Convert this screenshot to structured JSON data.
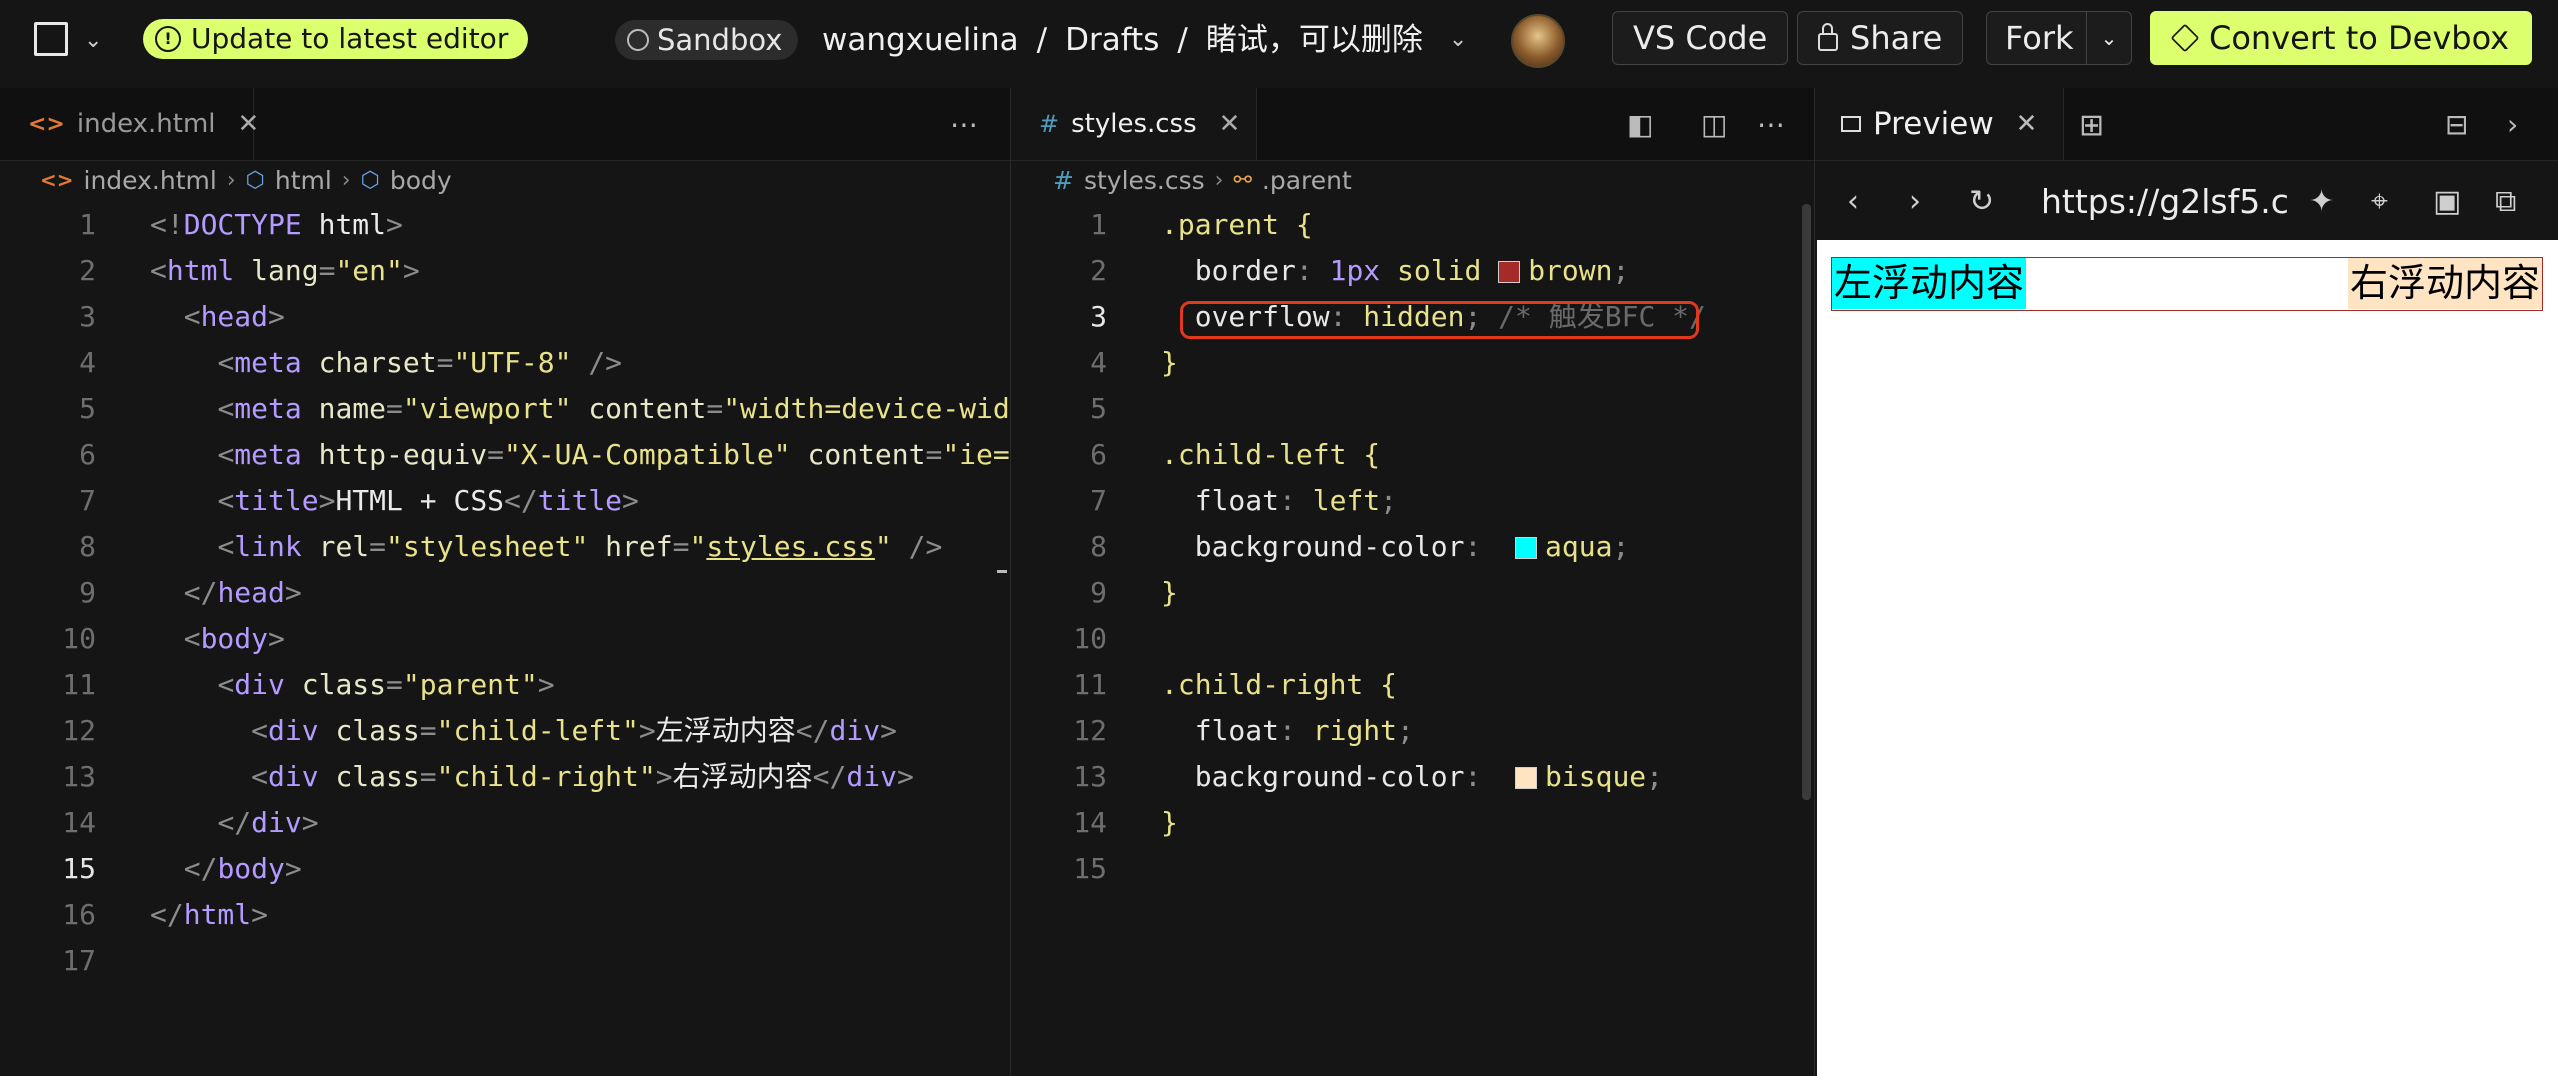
{
  "topbar": {
    "update_label": "Update to latest editor",
    "sandbox_label": "Sandbox",
    "path": [
      "wangxuelina",
      "/",
      "Drafts",
      "/",
      "睹试，可以删除"
    ],
    "vscode_label": "VS Code",
    "share_label": "Share",
    "fork_label": "Fork",
    "convert_label": "Convert to Devbox",
    "accent_color": "#dcff6e"
  },
  "left_pane": {
    "tab_label": "index.html",
    "breadcrumbs": [
      "index.html",
      "html",
      "body"
    ],
    "lines": [
      {
        "n": "1",
        "tokens": [
          [
            "p",
            "<!"
          ],
          [
            "tag",
            "DOCTYPE"
          ],
          [
            "txt",
            " html"
          ],
          [
            "p",
            ">"
          ]
        ]
      },
      {
        "n": "2",
        "tokens": [
          [
            "p",
            "<"
          ],
          [
            "tag",
            "html"
          ],
          [
            "attr",
            " lang"
          ],
          [
            "p",
            "="
          ],
          [
            "str",
            "\"en\""
          ],
          [
            "p",
            ">"
          ]
        ]
      },
      {
        "n": "3",
        "tokens": [
          [
            "txt",
            "  "
          ],
          [
            "p",
            "<"
          ],
          [
            "tag",
            "head"
          ],
          [
            "p",
            ">"
          ]
        ]
      },
      {
        "n": "4",
        "tokens": [
          [
            "txt",
            "    "
          ],
          [
            "p",
            "<"
          ],
          [
            "tag",
            "meta"
          ],
          [
            "attr",
            " charset"
          ],
          [
            "p",
            "="
          ],
          [
            "str",
            "\"UTF-8\""
          ],
          [
            "p",
            " />"
          ]
        ]
      },
      {
        "n": "5",
        "tokens": [
          [
            "txt",
            "    "
          ],
          [
            "p",
            "<"
          ],
          [
            "tag",
            "meta"
          ],
          [
            "attr",
            " name"
          ],
          [
            "p",
            "="
          ],
          [
            "str",
            "\"viewport\""
          ],
          [
            "attr",
            " content"
          ],
          [
            "p",
            "="
          ],
          [
            "str",
            "\"width=device-wid"
          ]
        ]
      },
      {
        "n": "6",
        "tokens": [
          [
            "txt",
            "    "
          ],
          [
            "p",
            "<"
          ],
          [
            "tag",
            "meta"
          ],
          [
            "attr",
            " http-equiv"
          ],
          [
            "p",
            "="
          ],
          [
            "str",
            "\"X-UA-Compatible\""
          ],
          [
            "attr",
            " content"
          ],
          [
            "p",
            "="
          ],
          [
            "str",
            "\"ie="
          ]
        ]
      },
      {
        "n": "7",
        "tokens": [
          [
            "txt",
            "    "
          ],
          [
            "p",
            "<"
          ],
          [
            "tag",
            "title"
          ],
          [
            "p",
            ">"
          ],
          [
            "txt",
            "HTML + CSS"
          ],
          [
            "p",
            "</"
          ],
          [
            "tag",
            "title"
          ],
          [
            "p",
            ">"
          ]
        ]
      },
      {
        "n": "8",
        "tokens": [
          [
            "txt",
            "    "
          ],
          [
            "p",
            "<"
          ],
          [
            "tag",
            "link"
          ],
          [
            "attr",
            " rel"
          ],
          [
            "p",
            "="
          ],
          [
            "str",
            "\"stylesheet\""
          ],
          [
            "attr",
            " href"
          ],
          [
            "p",
            "="
          ],
          [
            "str",
            "\""
          ],
          [
            "strU",
            "styles.css"
          ],
          [
            "str",
            "\""
          ],
          [
            "p",
            " />"
          ]
        ]
      },
      {
        "n": "9",
        "tokens": [
          [
            "txt",
            "  "
          ],
          [
            "p",
            "</"
          ],
          [
            "tag",
            "head"
          ],
          [
            "p",
            ">"
          ]
        ]
      },
      {
        "n": "10",
        "tokens": [
          [
            "txt",
            "  "
          ],
          [
            "p",
            "<"
          ],
          [
            "tag",
            "body"
          ],
          [
            "p",
            ">"
          ]
        ]
      },
      {
        "n": "11",
        "tokens": [
          [
            "txt",
            "    "
          ],
          [
            "p",
            "<"
          ],
          [
            "tag",
            "div"
          ],
          [
            "attr",
            " class"
          ],
          [
            "p",
            "="
          ],
          [
            "str",
            "\"parent\""
          ],
          [
            "p",
            ">"
          ]
        ]
      },
      {
        "n": "12",
        "tokens": [
          [
            "txt",
            "      "
          ],
          [
            "p",
            "<"
          ],
          [
            "tag",
            "div"
          ],
          [
            "attr",
            " class"
          ],
          [
            "p",
            "="
          ],
          [
            "str",
            "\"child-left\""
          ],
          [
            "p",
            ">"
          ],
          [
            "txt",
            "左浮动内容"
          ],
          [
            "p",
            "</"
          ],
          [
            "tag",
            "div"
          ],
          [
            "p",
            ">"
          ]
        ]
      },
      {
        "n": "13",
        "tokens": [
          [
            "txt",
            "      "
          ],
          [
            "p",
            "<"
          ],
          [
            "tag",
            "div"
          ],
          [
            "attr",
            " class"
          ],
          [
            "p",
            "="
          ],
          [
            "str",
            "\"child-right\""
          ],
          [
            "p",
            ">"
          ],
          [
            "txt",
            "右浮动内容"
          ],
          [
            "p",
            "</"
          ],
          [
            "tag",
            "div"
          ],
          [
            "p",
            ">"
          ]
        ]
      },
      {
        "n": "14",
        "tokens": [
          [
            "txt",
            "    "
          ],
          [
            "p",
            "</"
          ],
          [
            "tag",
            "div"
          ],
          [
            "p",
            ">"
          ]
        ]
      },
      {
        "n": "15",
        "tokens": [
          [
            "txt",
            "  "
          ],
          [
            "p",
            "</"
          ],
          [
            "tag",
            "body"
          ],
          [
            "p",
            ">"
          ]
        ]
      },
      {
        "n": "16",
        "tokens": [
          [
            "p",
            "</"
          ],
          [
            "tag",
            "html"
          ],
          [
            "p",
            ">"
          ]
        ]
      },
      {
        "n": "17",
        "tokens": []
      }
    ],
    "current_line": "15"
  },
  "mid_pane": {
    "tab_label": "styles.css",
    "breadcrumbs": [
      "styles.css",
      ".parent"
    ],
    "lines": [
      {
        "n": "1",
        "tokens": [
          [
            "sel",
            ".parent"
          ],
          [
            "txt",
            " "
          ],
          [
            "brace",
            "{"
          ]
        ]
      },
      {
        "n": "2",
        "tokens": [
          [
            "txt",
            "  "
          ],
          [
            "prop",
            "border"
          ],
          [
            "p",
            ": "
          ],
          [
            "num",
            "1px"
          ],
          [
            "txt",
            " "
          ],
          [
            "kw",
            "solid"
          ],
          [
            "txt",
            " "
          ],
          [
            "sw",
            "#a52a2a"
          ],
          [
            "kw",
            "brown"
          ],
          [
            "p",
            ";"
          ]
        ]
      },
      {
        "n": "3",
        "tokens": [
          [
            "txt",
            "  "
          ],
          [
            "prop",
            "overflow"
          ],
          [
            "p",
            ": "
          ],
          [
            "kw",
            "hidden"
          ],
          [
            "p",
            "; "
          ],
          [
            "com",
            "/* 触发BFC */"
          ]
        ]
      },
      {
        "n": "4",
        "tokens": [
          [
            "brace",
            "}"
          ]
        ]
      },
      {
        "n": "5",
        "tokens": []
      },
      {
        "n": "6",
        "tokens": [
          [
            "sel",
            ".child-left"
          ],
          [
            "txt",
            " "
          ],
          [
            "brace",
            "{"
          ]
        ]
      },
      {
        "n": "7",
        "tokens": [
          [
            "txt",
            "  "
          ],
          [
            "prop",
            "float"
          ],
          [
            "p",
            ": "
          ],
          [
            "kw",
            "left"
          ],
          [
            "p",
            ";"
          ]
        ]
      },
      {
        "n": "8",
        "tokens": [
          [
            "txt",
            "  "
          ],
          [
            "prop",
            "background-color"
          ],
          [
            "p",
            ":  "
          ],
          [
            "sw",
            "#00ffff"
          ],
          [
            "kw",
            "aqua"
          ],
          [
            "p",
            ";"
          ]
        ]
      },
      {
        "n": "9",
        "tokens": [
          [
            "brace",
            "}"
          ]
        ]
      },
      {
        "n": "10",
        "tokens": []
      },
      {
        "n": "11",
        "tokens": [
          [
            "sel",
            ".child-right"
          ],
          [
            "txt",
            " "
          ],
          [
            "brace",
            "{"
          ]
        ]
      },
      {
        "n": "12",
        "tokens": [
          [
            "txt",
            "  "
          ],
          [
            "prop",
            "float"
          ],
          [
            "p",
            ": "
          ],
          [
            "kw",
            "right"
          ],
          [
            "p",
            ";"
          ]
        ]
      },
      {
        "n": "13",
        "tokens": [
          [
            "txt",
            "  "
          ],
          [
            "prop",
            "background-color"
          ],
          [
            "p",
            ":  "
          ],
          [
            "sw",
            "#ffe4c4"
          ],
          [
            "kw",
            "bisque"
          ],
          [
            "p",
            ";"
          ]
        ]
      },
      {
        "n": "14",
        "tokens": [
          [
            "brace",
            "}"
          ]
        ]
      },
      {
        "n": "15",
        "tokens": []
      }
    ],
    "current_line": "3",
    "highlight_color": "#e0391c"
  },
  "preview": {
    "tab_label": "Preview",
    "url": "https://g2lsf5.c",
    "child_left_text": "左浮动内容",
    "child_right_text": "右浮动内容",
    "child_left_color": "#00ffff",
    "child_right_color": "#ffe4c4",
    "parent_border_color": "#a52a2a"
  },
  "icons": [
    "menu-square-icon",
    "chevron-down-icon",
    "info-icon",
    "sandbox-icon",
    "lock-icon",
    "cube-icon",
    "html-file-icon",
    "css-file-icon",
    "close-icon",
    "more-icon",
    "split-editor-icon",
    "toggle-panel-icon",
    "tag-icon",
    "selector-icon",
    "window-icon",
    "add-tab-icon",
    "layout-icon",
    "chevron-right-icon",
    "back-icon",
    "forward-icon",
    "refresh-icon",
    "magic-icon",
    "target-icon",
    "terminal-icon",
    "open-external-icon"
  ]
}
